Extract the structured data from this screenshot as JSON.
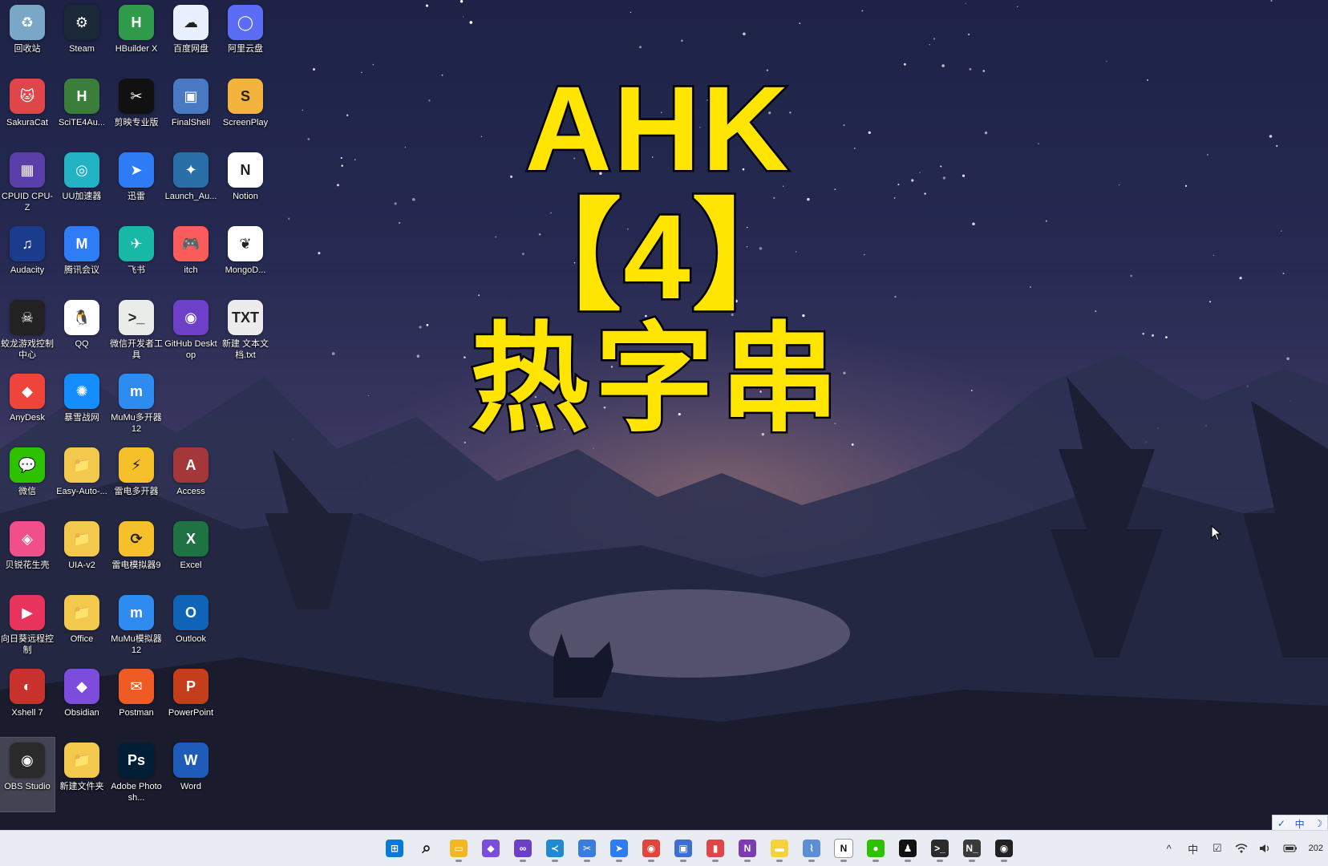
{
  "colors": {
    "title_fill": "#ffe500",
    "title_stroke": "#000000",
    "taskbar_bg": "#e9edf3"
  },
  "overlay": {
    "line1": "AHK【4】",
    "line2": "热字串"
  },
  "desktop_icons": [
    {
      "label": "回收站",
      "icon": "recycle-bin-icon",
      "color": "#7aa7c7",
      "glyph": "♻"
    },
    {
      "label": "Steam",
      "icon": "steam-icon",
      "color": "#1b2838",
      "glyph": "⚙"
    },
    {
      "label": "HBuilder X",
      "icon": "hbuilder-icon",
      "color": "#2f9a4a",
      "glyph": "H"
    },
    {
      "label": "百度网盘",
      "icon": "baidu-netdisk-icon",
      "color": "#e8f0ff",
      "glyph": "☁"
    },
    {
      "label": "阿里云盘",
      "icon": "aliyun-drive-icon",
      "color": "#5b6cf5",
      "glyph": "◯"
    },
    {
      "label": "SakuraCat",
      "icon": "sakuracat-icon",
      "color": "#e0454a",
      "glyph": "🐱"
    },
    {
      "label": "SciTE4Au...",
      "icon": "scite-icon",
      "color": "#3b7d3b",
      "glyph": "H"
    },
    {
      "label": "剪映专业版",
      "icon": "capcut-icon",
      "color": "#111111",
      "glyph": "✂"
    },
    {
      "label": "FinalShell",
      "icon": "finalshell-icon",
      "color": "#4a79c4",
      "glyph": "▣"
    },
    {
      "label": "ScreenPlay",
      "icon": "screenplay-icon",
      "color": "#f3b33d",
      "glyph": "S"
    },
    {
      "label": "CPUID CPU-Z",
      "icon": "cpuz-icon",
      "color": "#5a3fa8",
      "glyph": "▦"
    },
    {
      "label": "UU加速器",
      "icon": "uu-accelerator-icon",
      "color": "#21b3c4",
      "glyph": "◎"
    },
    {
      "label": "迅雷",
      "icon": "thunder-icon",
      "color": "#2d7cf6",
      "glyph": "➤"
    },
    {
      "label": "Launch_Au...",
      "icon": "launch-icon",
      "color": "#2a6fa8",
      "glyph": "✦"
    },
    {
      "label": "Notion",
      "icon": "notion-icon",
      "color": "#ffffff",
      "glyph": "N"
    },
    {
      "label": "Audacity",
      "icon": "audacity-icon",
      "color": "#1b3c8c",
      "glyph": "♫"
    },
    {
      "label": "腾讯会议",
      "icon": "tencent-meeting-icon",
      "color": "#2f7df6",
      "glyph": "M"
    },
    {
      "label": "飞书",
      "icon": "feishu-icon",
      "color": "#17b8a6",
      "glyph": "✈"
    },
    {
      "label": "itch",
      "icon": "itch-icon",
      "color": "#fa5c5c",
      "glyph": "🎮"
    },
    {
      "label": "MongoD...",
      "icon": "mongodb-icon",
      "color": "#ffffff",
      "glyph": "❦"
    },
    {
      "label": "蛟龙游戏控制中心",
      "icon": "game-control-icon",
      "color": "#222222",
      "glyph": "☠"
    },
    {
      "label": "QQ",
      "icon": "qq-icon",
      "color": "#ffffff",
      "glyph": "🐧"
    },
    {
      "label": "微信开发者工具",
      "icon": "wechat-devtools-icon",
      "color": "#e9ece9",
      "glyph": ">_"
    },
    {
      "label": "GitHub Desktop",
      "icon": "github-desktop-icon",
      "color": "#6e40c9",
      "glyph": "◉"
    },
    {
      "label": "新建 文本文档.txt",
      "icon": "text-file-icon",
      "color": "#ececec",
      "glyph": "TXT"
    },
    {
      "label": "AnyDesk",
      "icon": "anydesk-icon",
      "color": "#ef443b",
      "glyph": "◆"
    },
    {
      "label": "暴雪战网",
      "icon": "battlenet-icon",
      "color": "#148eff",
      "glyph": "✺"
    },
    {
      "label": "MuMu多开器12",
      "icon": "mumu-multi-icon",
      "color": "#2e8cf0",
      "glyph": "m"
    },
    {
      "label": "",
      "icon": "",
      "color": "",
      "glyph": ""
    },
    {
      "label": "",
      "icon": "",
      "color": "",
      "glyph": ""
    },
    {
      "label": "微信",
      "icon": "wechat-icon",
      "color": "#2dc100",
      "glyph": "💬"
    },
    {
      "label": "Easy-Auto-...",
      "icon": "folder-icon",
      "color": "#f2c94c",
      "glyph": "📁"
    },
    {
      "label": "雷电多开器",
      "icon": "ldplayer-multi-icon",
      "color": "#f5c02a",
      "glyph": "⚡"
    },
    {
      "label": "Access",
      "icon": "access-icon",
      "color": "#a4373a",
      "glyph": "A"
    },
    {
      "label": "",
      "icon": "",
      "color": "",
      "glyph": ""
    },
    {
      "label": "贝锐花生壳",
      "icon": "oray-icon",
      "color": "#f04f8a",
      "glyph": "◈"
    },
    {
      "label": "UIA-v2",
      "icon": "folder-icon",
      "color": "#f2c94c",
      "glyph": "📁"
    },
    {
      "label": "雷电模拟器9",
      "icon": "ldplayer-icon",
      "color": "#f5c02a",
      "glyph": "⟳"
    },
    {
      "label": "Excel",
      "icon": "excel-icon",
      "color": "#1f7244",
      "glyph": "X"
    },
    {
      "label": "",
      "icon": "",
      "color": "",
      "glyph": ""
    },
    {
      "label": "向日葵远程控制",
      "icon": "sunlogin-icon",
      "color": "#e8335c",
      "glyph": "▶"
    },
    {
      "label": "Office",
      "icon": "folder-icon",
      "color": "#f2c94c",
      "glyph": "📁"
    },
    {
      "label": "MuMu模拟器12",
      "icon": "mumu-icon",
      "color": "#2e8cf0",
      "glyph": "m"
    },
    {
      "label": "Outlook",
      "icon": "outlook-icon",
      "color": "#0f64b8",
      "glyph": "O"
    },
    {
      "label": "",
      "icon": "",
      "color": "",
      "glyph": ""
    },
    {
      "label": "Xshell 7",
      "icon": "xshell-icon",
      "color": "#c9312c",
      "glyph": "◐"
    },
    {
      "label": "Obsidian",
      "icon": "obsidian-icon",
      "color": "#7c4ddc",
      "glyph": "◆"
    },
    {
      "label": "Postman",
      "icon": "postman-icon",
      "color": "#ef5b25",
      "glyph": "✉"
    },
    {
      "label": "PowerPoint",
      "icon": "powerpoint-icon",
      "color": "#c43e1c",
      "glyph": "P"
    },
    {
      "label": "",
      "icon": "",
      "color": "",
      "glyph": ""
    },
    {
      "label": "OBS Studio",
      "icon": "obs-icon",
      "color": "#2a2a2a",
      "glyph": "◉",
      "selected": true
    },
    {
      "label": "新建文件夹",
      "icon": "folder-icon",
      "color": "#f2c94c",
      "glyph": "📁"
    },
    {
      "label": "Adobe Photosh...",
      "icon": "photoshop-icon",
      "color": "#001e36",
      "glyph": "Ps"
    },
    {
      "label": "Word",
      "icon": "word-icon",
      "color": "#1f5bb8",
      "glyph": "W"
    },
    {
      "label": "",
      "icon": "",
      "color": "",
      "glyph": ""
    }
  ],
  "taskbar": {
    "apps": [
      {
        "icon": "windows-start-icon",
        "color": "#0a78d7",
        "glyph": "⊞"
      },
      {
        "icon": "search-icon",
        "color": "#2b2b2b",
        "glyph": "⌕"
      },
      {
        "icon": "file-explorer-icon",
        "color": "#f2b824",
        "glyph": "▭"
      },
      {
        "icon": "obsidian-icon",
        "color": "#7c4ddc",
        "glyph": "◆"
      },
      {
        "icon": "visual-studio-icon",
        "color": "#6d3ec6",
        "glyph": "∞"
      },
      {
        "icon": "vscode-icon",
        "color": "#1f8ad2",
        "glyph": "≺"
      },
      {
        "icon": "snipping-tool-icon",
        "color": "#3b7ddd",
        "glyph": "✂"
      },
      {
        "icon": "thunder-icon",
        "color": "#2d7cf6",
        "glyph": "➤"
      },
      {
        "icon": "chrome-icon",
        "color": "#e0443a",
        "glyph": "◉"
      },
      {
        "icon": "remote-desktop-icon",
        "color": "#3b6fd1",
        "glyph": "▣"
      },
      {
        "icon": "sakuracat-icon",
        "color": "#e0454a",
        "glyph": "▮"
      },
      {
        "icon": "onenote-icon",
        "color": "#7d3ab3",
        "glyph": "N"
      },
      {
        "icon": "sticky-notes-icon",
        "color": "#f3d23a",
        "glyph": "▬"
      },
      {
        "icon": "performance-monitor-icon",
        "color": "#5a8fd8",
        "glyph": "⌇"
      },
      {
        "icon": "notion-icon",
        "color": "#ffffff",
        "glyph": "N"
      },
      {
        "icon": "wechat-icon",
        "color": "#2dc100",
        "glyph": "●"
      },
      {
        "icon": "qq-icon",
        "color": "#111111",
        "glyph": "♟"
      },
      {
        "icon": "terminal-icon",
        "color": "#2b2b2b",
        "glyph": ">_"
      },
      {
        "icon": "notion-terminal-icon",
        "color": "#3a3a3a",
        "glyph": "N_"
      },
      {
        "icon": "obs-icon",
        "color": "#222222",
        "glyph": "◉"
      }
    ],
    "tray": {
      "chevron": "^",
      "ime": "中",
      "clock": "202"
    }
  },
  "ime_toolbar": [
    "✓",
    "中",
    "☽"
  ]
}
